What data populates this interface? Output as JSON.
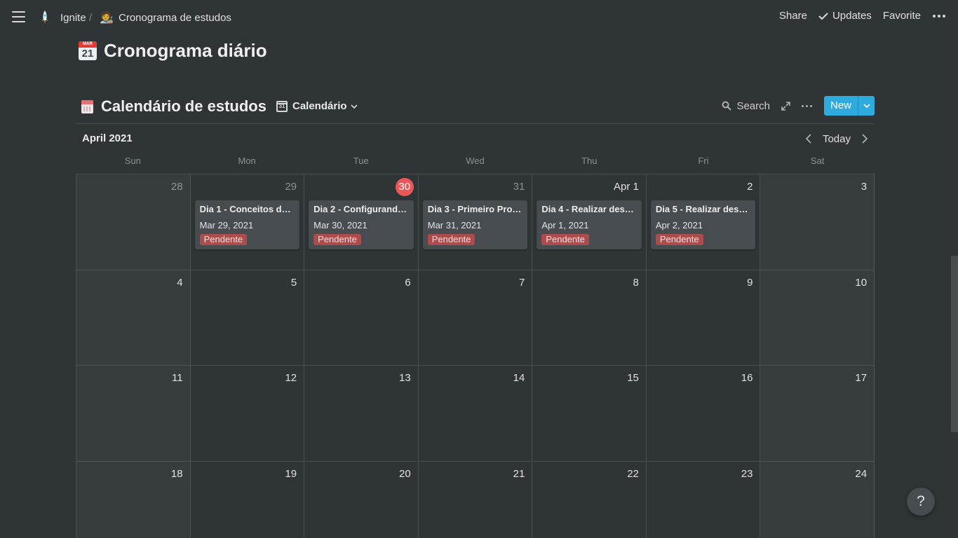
{
  "topbar": {
    "workspace": "Ignite",
    "separator": "/",
    "page_emoji": "🧑‍🎨",
    "page_name": "Cronograma de estudos",
    "share": "Share",
    "updates": "Updates",
    "favorite": "Favorite"
  },
  "page": {
    "icon_month": "MAR",
    "icon_day": "21",
    "title": "Cronograma diário"
  },
  "database": {
    "title": "Calendário de estudos",
    "view_icon_day": "31",
    "view_name": "Calendário",
    "search": "Search",
    "new_label": "New",
    "new_button_color": "#2eaadc"
  },
  "calendar": {
    "month": "April 2021",
    "today_label": "Today",
    "weekdays": [
      "Sun",
      "Mon",
      "Tue",
      "Wed",
      "Thu",
      "Fri",
      "Sat"
    ],
    "today_color": "#eb5757",
    "weeks": [
      [
        {
          "label": "28",
          "muted": true
        },
        {
          "label": "29",
          "muted": true,
          "event": 0
        },
        {
          "label": "30",
          "today": true,
          "event": 1
        },
        {
          "label": "31",
          "muted": true,
          "event": 2
        },
        {
          "label": "Apr 1",
          "event": 3
        },
        {
          "label": "2",
          "event": 4
        },
        {
          "label": "3"
        }
      ],
      [
        {
          "label": "4"
        },
        {
          "label": "5"
        },
        {
          "label": "6"
        },
        {
          "label": "7"
        },
        {
          "label": "8"
        },
        {
          "label": "9"
        },
        {
          "label": "10"
        }
      ],
      [
        {
          "label": "11"
        },
        {
          "label": "12"
        },
        {
          "label": "13"
        },
        {
          "label": "14"
        },
        {
          "label": "15"
        },
        {
          "label": "16"
        },
        {
          "label": "17"
        }
      ],
      [
        {
          "label": "18"
        },
        {
          "label": "19"
        },
        {
          "label": "20"
        },
        {
          "label": "21"
        },
        {
          "label": "22"
        },
        {
          "label": "23"
        },
        {
          "label": "24"
        }
      ]
    ],
    "events": [
      {
        "title": "Dia 1 - Conceitos d…",
        "date": "Mar 29, 2021",
        "status": "Pendente"
      },
      {
        "title": "Dia 2 - Configurand…",
        "date": "Mar 30, 2021",
        "status": "Pendente"
      },
      {
        "title": "Dia 3 - Primeiro Pro…",
        "date": "Mar 31, 2021",
        "status": "Pendente"
      },
      {
        "title": "Dia 4 - Realizar des…",
        "date": "Apr 1, 2021",
        "status": "Pendente"
      },
      {
        "title": "Dia 5 - Realizar des…",
        "date": "Apr 2, 2021",
        "status": "Pendente"
      }
    ],
    "status_color": "#ad4c4c"
  },
  "help": "?"
}
